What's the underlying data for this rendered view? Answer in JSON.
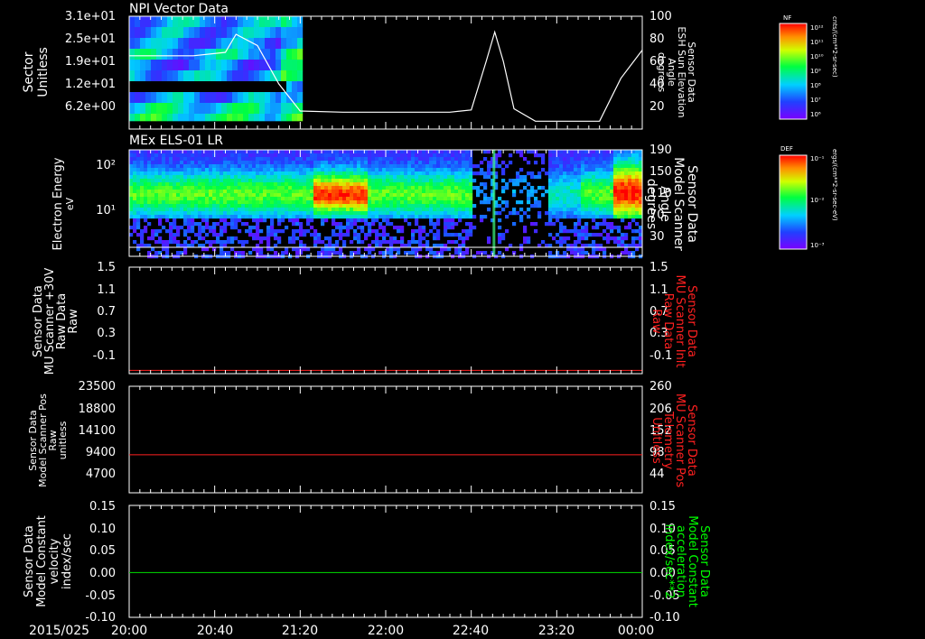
{
  "colors": {
    "background": "#000000",
    "axis": "#ffffff",
    "red_trace": "#ff2020",
    "green_trace": "#00e000",
    "label_red": "#ff2020",
    "label_green": "#00ff00"
  },
  "date_label": "2015/025",
  "time_ticks": [
    "20:00",
    "20:40",
    "21:20",
    "22:00",
    "22:40",
    "23:20",
    "00:00"
  ],
  "panels": [
    {
      "title": "NPI Vector Data",
      "left_label": [
        "Sector",
        "Unitless"
      ],
      "left_ticks": [
        "3.1e+01",
        "2.5e+01",
        "1.9e+01",
        "1.2e+01",
        "6.2e+00"
      ],
      "right_label": [
        "Sensor Data",
        "ESH Sun Elevation",
        "Angle",
        "degrees"
      ],
      "right_ticks": [
        "100",
        "80",
        "60",
        "40",
        "20"
      ],
      "colorbar": {
        "title": "NF",
        "units": "cnts/(cm**2-sr-sec)",
        "ticks": [
          "10¹²",
          "10¹¹",
          "10¹⁰",
          "10⁹",
          "10⁸",
          "10⁷",
          "10⁶"
        ]
      }
    },
    {
      "title": "MEx ELS-01 LR",
      "left_label": [
        "Electron Energy",
        "eV"
      ],
      "left_ticks": [
        "10²",
        "10¹"
      ],
      "right_label": [
        "Sensor Data",
        "Model Scanner",
        "Angle",
        "degrees"
      ],
      "right_ticks": [
        "190",
        "150",
        "110",
        "70",
        "30"
      ],
      "colorbar": {
        "title": "DEF",
        "units": "ergs/(cm**2-sr-sec-eV)",
        "ticks": [
          "10⁻¹",
          "10⁻²",
          "10⁻³"
        ]
      }
    },
    {
      "left_label": [
        "Sensor Data",
        "MU Scanner +30V",
        "Raw Data",
        "Raw"
      ],
      "left_ticks": [
        "1.5",
        "1.1",
        "0.7",
        "0.3",
        "-0.1"
      ],
      "right_label": [
        "Sensor Data",
        "MU Scanner Inlt",
        "Raw Data",
        "Raw"
      ],
      "right_ticks": [
        "1.5",
        "1.1",
        "0.7",
        "0.3",
        "-0.1"
      ]
    },
    {
      "left_label": [
        "Sensor Data",
        "Model Scanner Pos",
        "Raw",
        "unitless"
      ],
      "left_ticks": [
        "23500",
        "18800",
        "14100",
        "9400",
        "4700"
      ],
      "right_label": [
        "Sensor Data",
        "MU Scanner Pos",
        "Telemetry",
        "Unitless"
      ],
      "right_ticks": [
        "260",
        "206",
        "152",
        "98",
        "44"
      ]
    },
    {
      "left_label": [
        "Sensor Data",
        "Model Constant",
        "velocity",
        "index/sec"
      ],
      "left_ticks": [
        "0.15",
        "0.10",
        "0.05",
        "0.00",
        "-0.05",
        "-0.10"
      ],
      "right_label": [
        "Sensor Data",
        "Model Constant",
        "acceleration",
        "index/sec**2"
      ],
      "right_ticks": [
        "0.15",
        "0.10",
        "0.05",
        "0.00",
        "-0.05",
        "-0.10"
      ]
    }
  ],
  "chart_data": [
    {
      "type": "heatmap",
      "title": "NPI Vector Data",
      "ylabel": "Sector Unitless",
      "x_range": [
        "20:00",
        "00:00"
      ],
      "ylim": [
        0,
        31
      ],
      "data_end": "21:21",
      "overlay_line": {
        "name": "ESH Sun Elevation Angle",
        "ylim": [
          0,
          100
        ],
        "x": [
          "20:00",
          "20:30",
          "20:45",
          "20:50",
          "21:00",
          "21:10",
          "21:20",
          "21:40",
          "22:00",
          "22:30",
          "22:40",
          "22:47",
          "22:51",
          "22:55",
          "23:00",
          "23:10",
          "23:40",
          "23:50",
          "00:00"
        ],
        "y": [
          65,
          65,
          68,
          84,
          74,
          40,
          16,
          15,
          15,
          15,
          17,
          60,
          86,
          60,
          18,
          7,
          7,
          45,
          70
        ]
      }
    },
    {
      "type": "heatmap",
      "title": "MEx ELS-01 LR",
      "ylabel": "Electron Energy eV",
      "x_range": [
        "20:00",
        "00:00"
      ],
      "yscale": "log",
      "overlay_line": {
        "name": "Model Scanner Angle",
        "ylim": [
          10,
          190
        ],
        "x": [
          "20:00",
          "00:00"
        ],
        "y": [
          12,
          12
        ]
      }
    },
    {
      "type": "line",
      "x": [
        "20:00",
        "00:00"
      ],
      "ylim": [
        -0.1,
        1.5
      ],
      "series": [
        {
          "values": [
            -0.05,
            -0.05
          ]
        }
      ]
    },
    {
      "type": "line",
      "x": [
        "20:00",
        "00:00"
      ],
      "ylim": [
        0,
        23500
      ],
      "series": [
        {
          "values": [
            8400,
            8400
          ]
        }
      ]
    },
    {
      "type": "line",
      "x": [
        "20:00",
        "00:00"
      ],
      "ylim": [
        -0.1,
        0.15
      ],
      "series": [
        {
          "values": [
            0.0,
            0.0
          ]
        }
      ]
    }
  ]
}
